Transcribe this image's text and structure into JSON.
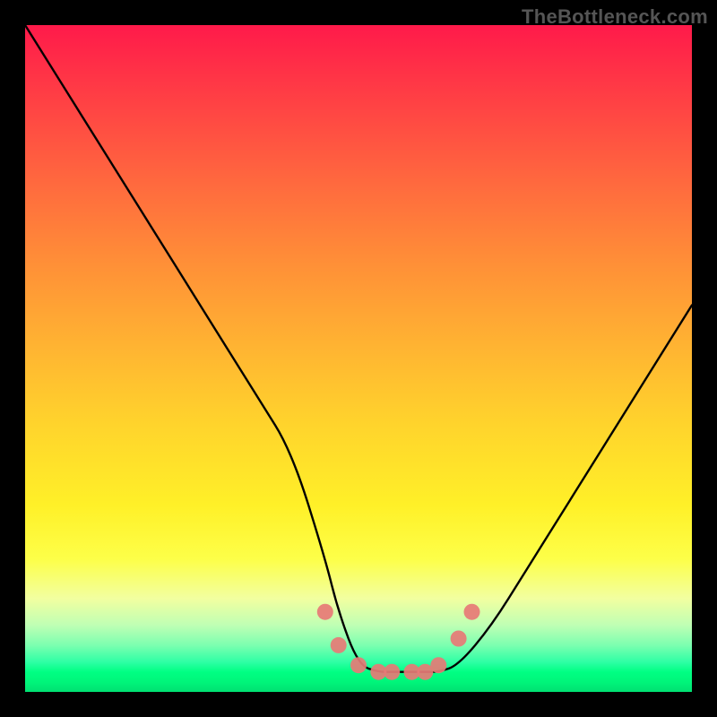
{
  "watermark": "TheBottleneck.com",
  "chart_data": {
    "type": "line",
    "title": "",
    "xlabel": "",
    "ylabel": "",
    "xlim": [
      0,
      100
    ],
    "ylim": [
      0,
      100
    ],
    "x": [
      0,
      5,
      10,
      15,
      20,
      25,
      30,
      35,
      40,
      45,
      47,
      50,
      53,
      55,
      58,
      60,
      62,
      65,
      70,
      75,
      80,
      85,
      90,
      95,
      100
    ],
    "values": [
      100,
      92,
      84,
      76,
      68,
      60,
      52,
      44,
      36,
      20,
      12,
      4,
      3,
      3,
      3,
      3,
      3,
      4,
      10,
      18,
      26,
      34,
      42,
      50,
      58
    ],
    "marker_points": [
      {
        "x": 45,
        "y": 12
      },
      {
        "x": 47,
        "y": 7
      },
      {
        "x": 50,
        "y": 4
      },
      {
        "x": 53,
        "y": 3
      },
      {
        "x": 55,
        "y": 3
      },
      {
        "x": 58,
        "y": 3
      },
      {
        "x": 60,
        "y": 3
      },
      {
        "x": 62,
        "y": 4
      },
      {
        "x": 65,
        "y": 8
      },
      {
        "x": 67,
        "y": 12
      }
    ],
    "gradient_stops": [
      {
        "pos": 0.0,
        "color": "#ff1a4a"
      },
      {
        "pos": 0.5,
        "color": "#ffd027"
      },
      {
        "pos": 0.85,
        "color": "#f6ff80"
      },
      {
        "pos": 1.0,
        "color": "#00e072"
      }
    ],
    "curve_color": "#000000",
    "marker_color": "#e77a76"
  }
}
